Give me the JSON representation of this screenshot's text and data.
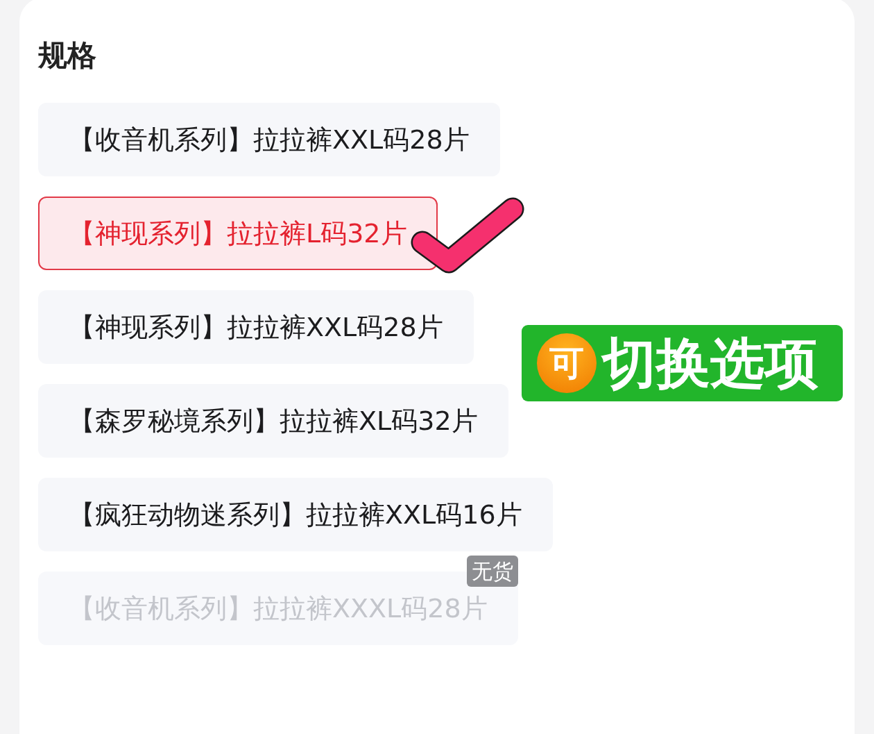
{
  "section": {
    "title": "规格"
  },
  "options": [
    {
      "label": "【收音机系列】拉拉裤XXL码28片",
      "selected": false,
      "disabled": false
    },
    {
      "label": "【神现系列】拉拉裤L码32片",
      "selected": true,
      "disabled": false
    },
    {
      "label": "【神现系列】拉拉裤XXL码28片",
      "selected": false,
      "disabled": false
    },
    {
      "label": "【森罗秘境系列】拉拉裤XL码32片",
      "selected": false,
      "disabled": false
    },
    {
      "label": "【疯狂动物迷系列】拉拉裤XXL码16片",
      "selected": false,
      "disabled": false
    },
    {
      "label": "【收音机系列】拉拉裤XXXL码28片",
      "selected": false,
      "disabled": true,
      "badge": "无货"
    }
  ],
  "annotation": {
    "badge": "可",
    "text": "切换选项"
  }
}
